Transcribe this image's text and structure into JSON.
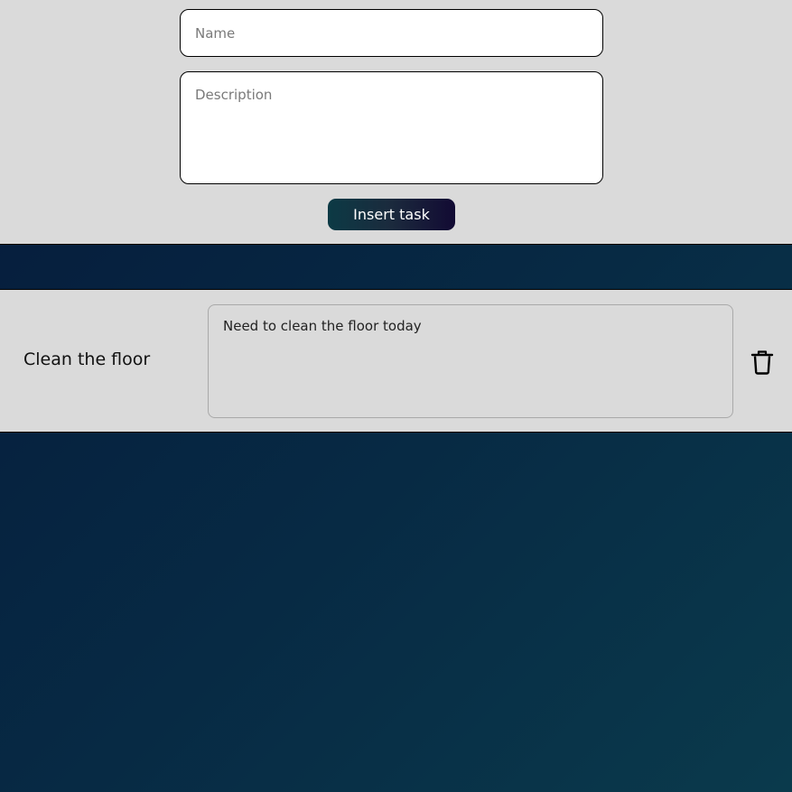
{
  "form": {
    "name_placeholder": "Name",
    "name_value": "",
    "description_placeholder": "Description",
    "description_value": "",
    "insert_label": "Insert task"
  },
  "tasks": [
    {
      "title": "Clean the floor",
      "description": "Need to clean the floor today",
      "delete_icon": "trash-icon"
    }
  ],
  "colors": {
    "panel_bg": "#dadada",
    "page_gradient_start": "#051a3b",
    "page_gradient_end": "#0a3a4c"
  }
}
